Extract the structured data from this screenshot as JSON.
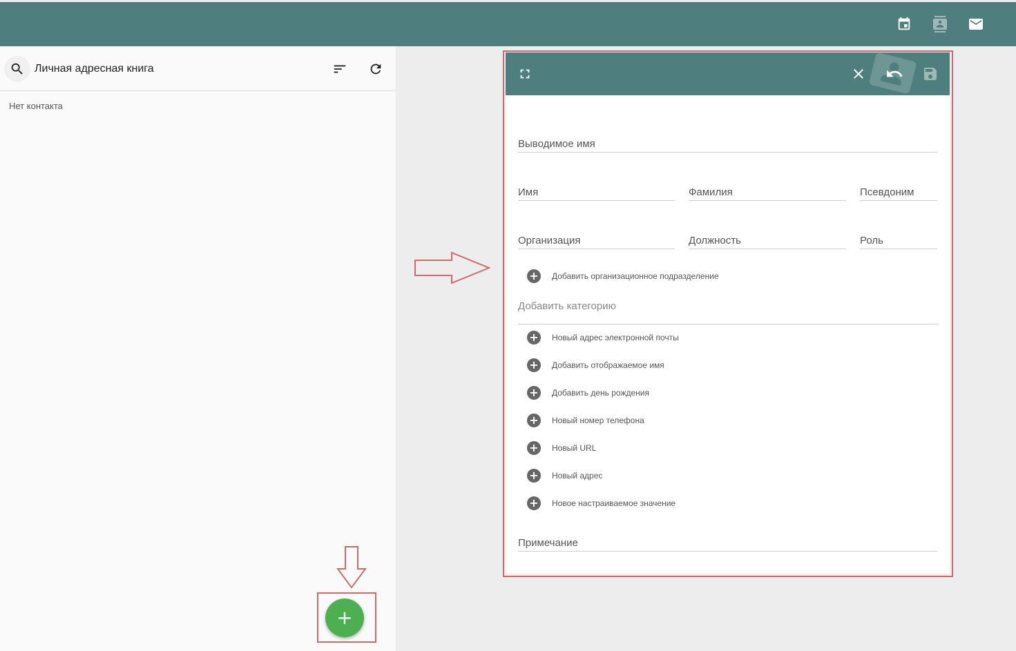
{
  "colors": {
    "header": "#4e7f7e",
    "fab": "#4caf50",
    "highlight": "#d06a6a"
  },
  "topbar": {
    "icons": [
      "calendar-icon",
      "contacts-icon",
      "mail-icon"
    ]
  },
  "left_panel": {
    "search_placeholder": "Личная адресная книга",
    "empty_text": "Нет контакта",
    "fab_label": "+"
  },
  "editor": {
    "display_name": "Выводимое имя",
    "first_name": "Имя",
    "last_name": "Фамилия",
    "nickname": "Псевдоним",
    "organization": "Организация",
    "job_title": "Должность",
    "role": "Роль",
    "add_department": "Добавить организационное подразделение",
    "add_category": "Добавить категорию",
    "add_items": [
      "Новый адрес электронной почты",
      "Добавить отображаемое имя",
      "Добавить день рождения",
      "Новый номер телефона",
      "Новый URL",
      "Новый адрес",
      "Новое настраиваемое значение"
    ],
    "note": "Примечание"
  }
}
